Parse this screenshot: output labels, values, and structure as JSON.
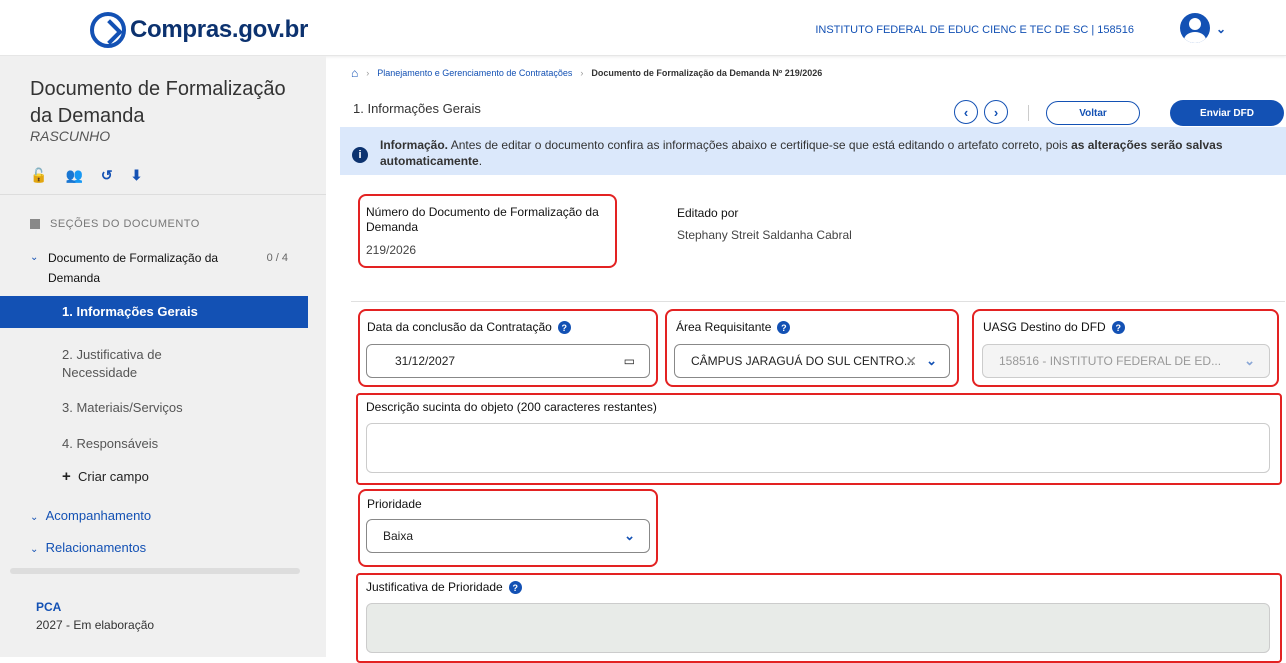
{
  "header": {
    "logo_text": "Compras.gov.br",
    "org": "INSTITUTO FEDERAL DE EDUC CIENC E TEC DE SC | 158516",
    "avatar_caret": "⌄"
  },
  "sidebar": {
    "title": "Documento de Formalização da Demanda",
    "status": "RASCUNHO",
    "action_icons": [
      "unlock-icon",
      "users-icon",
      "history-icon",
      "download-icon"
    ],
    "sections_label": "SEÇÕES DO DOCUMENTO",
    "doc_group": {
      "label": "Documento de Formalização da Demanda",
      "count": "0 / 4"
    },
    "items": [
      {
        "label": "1.  Informações Gerais"
      },
      {
        "label": "2.  Justificativa de Necessidade"
      },
      {
        "label": "3.  Materiais/Serviços"
      },
      {
        "label": "4.  Responsáveis"
      }
    ],
    "create_field": "Criar campo",
    "acompanhamento": "Acompanhamento",
    "relacionamentos": "Relacionamentos",
    "pca_title": "PCA",
    "pca_value": "2027 - Em elaboração"
  },
  "breadcrumb": {
    "item1": "Planejamento e Gerenciamento de Contratações",
    "current": "Documento de Formalização da Demanda Nº 219/2026"
  },
  "main": {
    "section_title": "1. Informações Gerais",
    "voltar": "Voltar",
    "enviar": "Enviar DFD",
    "info_bold": "Informação.",
    "info_text": " Antes de editar o documento confira as informações abaixo e certifique-se que está editando o artefato correto, pois ",
    "info_bold2": "as alterações serão salvas automaticamente",
    "info_end": ".",
    "doc_number_label": "Número do Documento de Formalização da Demanda",
    "doc_number": "219/2026",
    "edited_by_label": "Editado por",
    "edited_by": "Stephany Streit Saldanha Cabral",
    "date_label": "Data da conclusão da Contratação",
    "date_value": "31/12/2027",
    "area_label": "Área Requisitante",
    "area_value": "CÂMPUS JARAGUÁ DO SUL CENTRO...",
    "uasg_label": "UASG Destino do DFD",
    "uasg_value": "158516 - INSTITUTO FEDERAL DE ED...",
    "desc_label": "Descrição sucinta do objeto (200 caracteres restantes)",
    "priority_label": "Prioridade",
    "priority_value": "Baixa",
    "justif_label": "Justificativa de Prioridade"
  }
}
